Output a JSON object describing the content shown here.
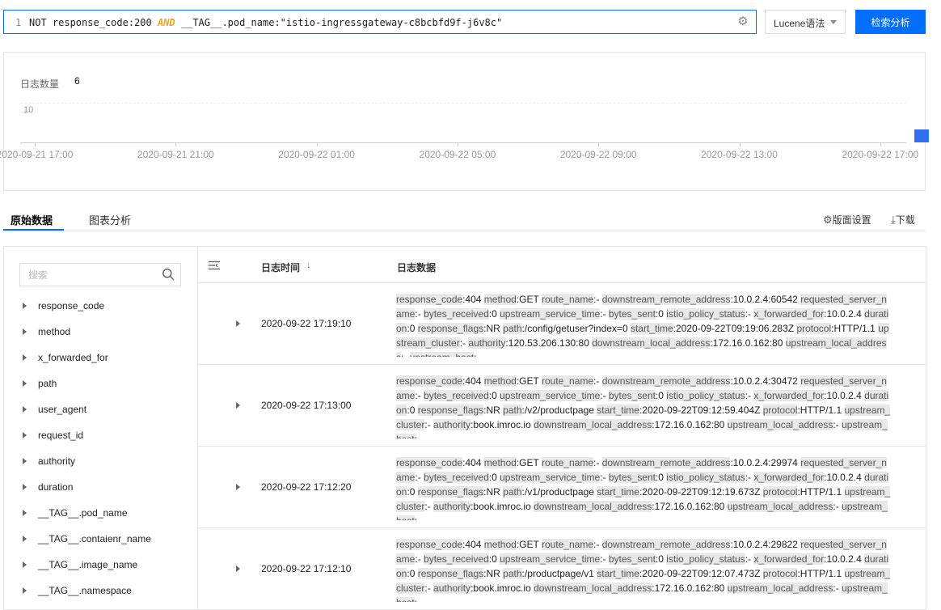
{
  "query": {
    "line_no": "1",
    "parts": [
      {
        "text": "NOT response_code:200 ",
        "cls": ""
      },
      {
        "text": "AND",
        "cls": "kw-and"
      },
      {
        "text": " __TAG__.pod_name:\"istio-ingressgateway-c8bcbfd9f-j6v8c\"",
        "cls": "str"
      }
    ],
    "settings_icon": "gear-icon"
  },
  "syntax_select": {
    "value": "Lucene语法"
  },
  "search_button": {
    "label": "检索分析"
  },
  "histogram": {
    "count_label": "日志数量",
    "count_value": "6"
  },
  "chart_data": {
    "type": "bar",
    "ytick_labels": [
      "10"
    ],
    "ylim": [
      0,
      10
    ],
    "x_ticks": [
      "2020-09-21 17:00",
      "2020-09-21 21:00",
      "2020-09-22 01:00",
      "2020-09-22 05:00",
      "2020-09-22 09:00",
      "2020-09-22 13:00",
      "2020-09-22 17:00"
    ],
    "categories": [
      "2020-09-22 17:00"
    ],
    "values": [
      6
    ],
    "grid": true,
    "color": "#2f6ff0"
  },
  "tabs": [
    {
      "label": "原始数据",
      "active": true
    },
    {
      "label": "图表分析",
      "active": false
    }
  ],
  "toolbar": {
    "layout_label": "版面设置",
    "layout_icon": "gear-icon",
    "download_label": "下载",
    "download_icon": "download-icon"
  },
  "field_search": {
    "placeholder": "搜索",
    "icon": "search-icon"
  },
  "fields": [
    "response_code",
    "method",
    "x_forwarded_for",
    "path",
    "user_agent",
    "request_id",
    "authority",
    "duration",
    "__TAG__.pod_name",
    "__TAG__.contaienr_name",
    "__TAG__.image_name",
    "__TAG__.namespace"
  ],
  "table": {
    "col_icon": "list-collapse-icon",
    "col_time": "日志时间",
    "sort_indicator": "↓",
    "col_data": "日志数据"
  },
  "logs": [
    {
      "time": "2020-09-22 17:19:10",
      "kv": [
        [
          "response_code",
          "404"
        ],
        [
          "method",
          "GET"
        ],
        [
          "route_name",
          "-"
        ],
        [
          "downstream_remote_address",
          "10.0.2.4:60542"
        ],
        [
          "requested_server_name",
          "-"
        ],
        [
          "bytes_received",
          "0"
        ],
        [
          "upstream_service_time",
          "-"
        ],
        [
          "bytes_sent",
          "0"
        ],
        [
          "istio_policy_status",
          "-"
        ],
        [
          "x_forwarded_for",
          "10.0.2.4"
        ],
        [
          "duration",
          "0"
        ],
        [
          "response_flags",
          "NR"
        ],
        [
          "path",
          "/config/getuser?index=0"
        ],
        [
          "start_time",
          "2020-09-22T09:19:06.283Z"
        ],
        [
          "protocol",
          "HTTP/1.1"
        ],
        [
          "upstream_cluster",
          "-"
        ],
        [
          "authority",
          "120.53.206.130:80"
        ],
        [
          "downstream_local_address",
          "172.16.0.162:80"
        ],
        [
          "upstream_local_address",
          "-"
        ],
        [
          "upstream_host",
          "-"
        ]
      ]
    },
    {
      "time": "2020-09-22 17:13:00",
      "kv": [
        [
          "response_code",
          "404"
        ],
        [
          "method",
          "GET"
        ],
        [
          "route_name",
          "-"
        ],
        [
          "downstream_remote_address",
          "10.0.2.4:30472"
        ],
        [
          "requested_server_name",
          "-"
        ],
        [
          "bytes_received",
          "0"
        ],
        [
          "upstream_service_time",
          "-"
        ],
        [
          "bytes_sent",
          "0"
        ],
        [
          "istio_policy_status",
          "-"
        ],
        [
          "x_forwarded_for",
          "10.0.2.4"
        ],
        [
          "duration",
          "0"
        ],
        [
          "response_flags",
          "NR"
        ],
        [
          "path",
          "/v2/productpage"
        ],
        [
          "start_time",
          "2020-09-22T09:12:59.404Z"
        ],
        [
          "protocol",
          "HTTP/1.1"
        ],
        [
          "upstream_cluster",
          "-"
        ],
        [
          "authority",
          "book.imroc.io"
        ],
        [
          "downstream_local_address",
          "172.16.0.162:80"
        ],
        [
          "upstream_local_address",
          "-"
        ],
        [
          "upstream_host",
          "-"
        ]
      ]
    },
    {
      "time": "2020-09-22 17:12:20",
      "kv": [
        [
          "response_code",
          "404"
        ],
        [
          "method",
          "GET"
        ],
        [
          "route_name",
          "-"
        ],
        [
          "downstream_remote_address",
          "10.0.2.4:29974"
        ],
        [
          "requested_server_name",
          "-"
        ],
        [
          "bytes_received",
          "0"
        ],
        [
          "upstream_service_time",
          "-"
        ],
        [
          "bytes_sent",
          "0"
        ],
        [
          "istio_policy_status",
          "-"
        ],
        [
          "x_forwarded_for",
          "10.0.2.4"
        ],
        [
          "duration",
          "0"
        ],
        [
          "response_flags",
          "NR"
        ],
        [
          "path",
          "/v1/productpage"
        ],
        [
          "start_time",
          "2020-09-22T09:12:19.673Z"
        ],
        [
          "protocol",
          "HTTP/1.1"
        ],
        [
          "upstream_cluster",
          "-"
        ],
        [
          "authority",
          "book.imroc.io"
        ],
        [
          "downstream_local_address",
          "172.16.0.162:80"
        ],
        [
          "upstream_local_address",
          "-"
        ],
        [
          "upstream_host",
          "-"
        ]
      ]
    },
    {
      "time": "2020-09-22 17:12:10",
      "kv": [
        [
          "response_code",
          "404"
        ],
        [
          "method",
          "GET"
        ],
        [
          "route_name",
          "-"
        ],
        [
          "downstream_remote_address",
          "10.0.2.4:29822"
        ],
        [
          "requested_server_name",
          "-"
        ],
        [
          "bytes_received",
          "0"
        ],
        [
          "upstream_service_time",
          "-"
        ],
        [
          "bytes_sent",
          "0"
        ],
        [
          "istio_policy_status",
          "-"
        ],
        [
          "x_forwarded_for",
          "10.0.2.4"
        ],
        [
          "duration",
          "0"
        ],
        [
          "response_flags",
          "NR"
        ],
        [
          "path",
          "/productpage/v1"
        ],
        [
          "start_time",
          "2020-09-22T09:12:07.473Z"
        ],
        [
          "protocol",
          "HTTP/1.1"
        ],
        [
          "upstream_cluster",
          "-"
        ],
        [
          "authority",
          "book.imroc.io"
        ],
        [
          "downstream_local_address",
          "172.16.0.162:80"
        ],
        [
          "upstream_local_address",
          "-"
        ],
        [
          "upstream_host",
          "-"
        ]
      ]
    }
  ]
}
